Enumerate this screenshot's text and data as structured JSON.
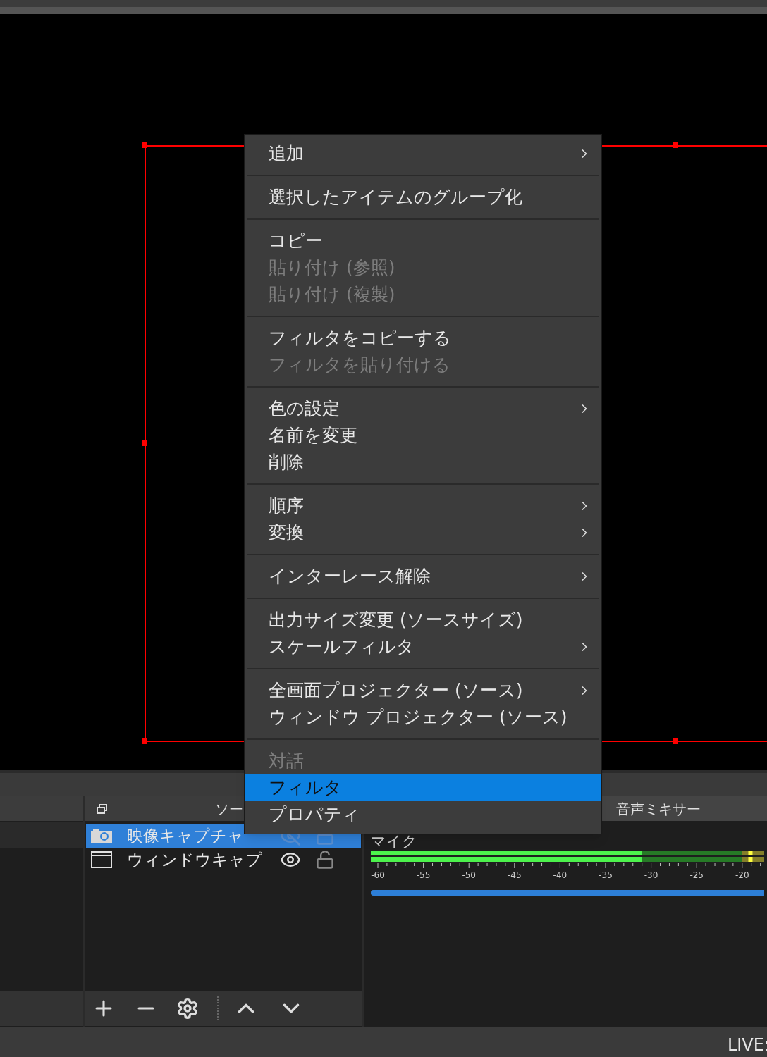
{
  "context_menu": {
    "groups": [
      {
        "items": [
          {
            "label": "追加",
            "submenu": true,
            "disabled": false,
            "selected": false
          }
        ]
      },
      {
        "items": [
          {
            "label": "選択したアイテムのグループ化",
            "submenu": false,
            "disabled": false,
            "selected": false
          }
        ]
      },
      {
        "items": [
          {
            "label": "コピー",
            "submenu": false,
            "disabled": false,
            "selected": false
          },
          {
            "label": "貼り付け (参照)",
            "submenu": false,
            "disabled": true,
            "selected": false
          },
          {
            "label": "貼り付け (複製)",
            "submenu": false,
            "disabled": true,
            "selected": false
          }
        ]
      },
      {
        "items": [
          {
            "label": "フィルタをコピーする",
            "submenu": false,
            "disabled": false,
            "selected": false
          },
          {
            "label": "フィルタを貼り付ける",
            "submenu": false,
            "disabled": true,
            "selected": false
          }
        ]
      },
      {
        "items": [
          {
            "label": "色の設定",
            "submenu": true,
            "disabled": false,
            "selected": false
          },
          {
            "label": "名前を変更",
            "submenu": false,
            "disabled": false,
            "selected": false
          },
          {
            "label": "削除",
            "submenu": false,
            "disabled": false,
            "selected": false
          }
        ]
      },
      {
        "items": [
          {
            "label": "順序",
            "submenu": true,
            "disabled": false,
            "selected": false
          },
          {
            "label": "変換",
            "submenu": true,
            "disabled": false,
            "selected": false
          }
        ]
      },
      {
        "items": [
          {
            "label": "インターレース解除",
            "submenu": true,
            "disabled": false,
            "selected": false
          }
        ]
      },
      {
        "items": [
          {
            "label": "出力サイズ変更 (ソースサイズ)",
            "submenu": false,
            "disabled": false,
            "selected": false
          },
          {
            "label": "スケールフィルタ",
            "submenu": true,
            "disabled": false,
            "selected": false
          }
        ]
      },
      {
        "items": [
          {
            "label": "全画面プロジェクター (ソース)",
            "submenu": true,
            "disabled": false,
            "selected": false
          },
          {
            "label": "ウィンドウ プロジェクター (ソース)",
            "submenu": false,
            "disabled": false,
            "selected": false
          }
        ]
      },
      {
        "items": [
          {
            "label": "対話",
            "submenu": false,
            "disabled": true,
            "selected": false
          },
          {
            "label": "フィルタ",
            "submenu": false,
            "disabled": false,
            "selected": true
          },
          {
            "label": "プロパティ",
            "submenu": false,
            "disabled": false,
            "selected": false
          }
        ]
      }
    ]
  },
  "sources_dock": {
    "title": "ソー",
    "items": [
      {
        "kind": "camera",
        "name": "映像キャプチャ",
        "selected": true,
        "visible": false,
        "locked": false
      },
      {
        "kind": "window",
        "name": "ウィンドウキャプ",
        "selected": false,
        "visible": true,
        "locked": false
      }
    ]
  },
  "audio_mixer": {
    "title": "音声ミキサー",
    "channels": [
      {
        "name": "マイク",
        "meter": {
          "level": 0.69
        },
        "peak_hold": {
          "level": 0.965
        },
        "volume": {
          "level": 1
        },
        "scale": [
          "-60",
          "-55",
          "-50",
          "-45",
          "-40",
          "-35",
          "-30",
          "-25",
          "-20"
        ]
      }
    ]
  },
  "status_bar": {
    "live": "LIVE:"
  }
}
